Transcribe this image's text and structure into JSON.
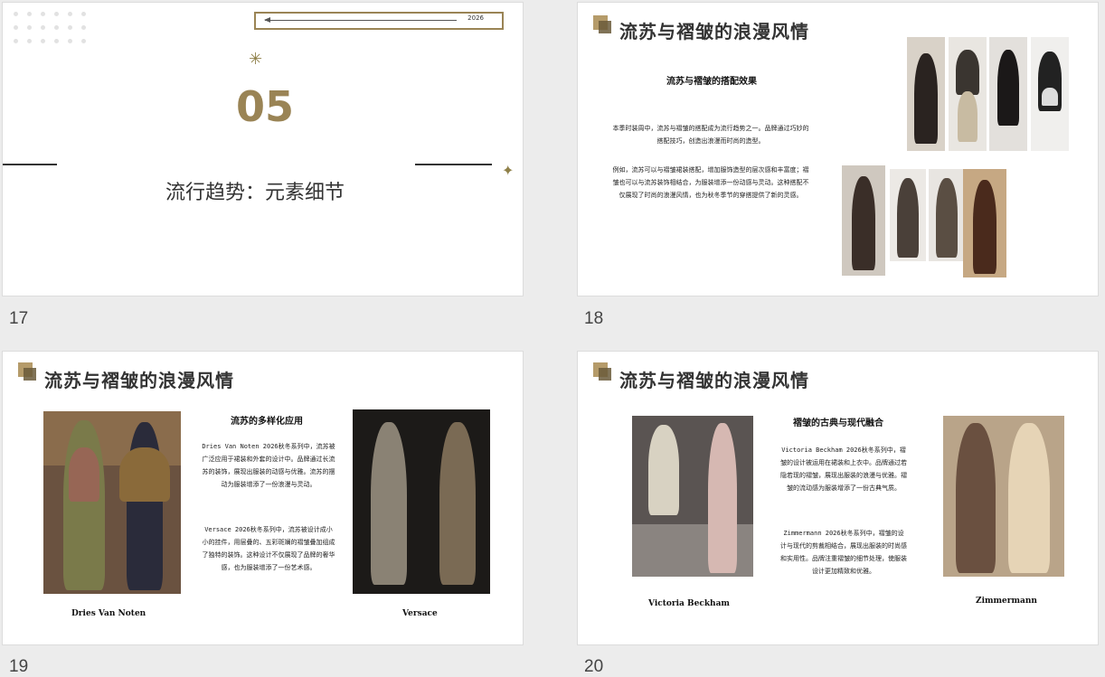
{
  "slides": [
    {
      "number": "17",
      "year": "2026",
      "big_number": "05",
      "subtitle": "流行趋势：元素细节"
    },
    {
      "number": "18",
      "title": "流苏与褶皱的浪漫风情",
      "subheading": "流苏与褶皱的搭配效果",
      "p1": "本季时装周中，流苏与褶皱的搭配成为流行趋势之一。品牌通过巧妙的搭配技巧，创造出浪漫而时尚的造型。",
      "p2": "例如，流苏可以与褶皱裙装搭配，增加服饰造型的层次感和丰富度；褶皱也可以与流苏装饰相结合，为服装增添一份动感与灵动。这种搭配不仅展现了时尚的浪漫风情，也为秋冬季节的穿搭提供了新的灵感。"
    },
    {
      "number": "19",
      "title": "流苏与褶皱的浪漫风情",
      "subheading": "流苏的多样化应用",
      "p1": "Dries Van Noten 2026秋冬系列中，流苏被广泛应用于裙装和外套的设计中。品牌通过长流苏的装饰，展现出服装的动感与优雅。流苏的摆动为服装增添了一份浪漫与灵动。",
      "p2": "Versace 2026秋冬系列中，流苏被设计成小小的挂件，用层叠的、五彩斑斓的褶皱叠加组成了独特的装饰。这种设计不仅展现了品牌的奢华感，也为服装增添了一份艺术感。",
      "caption_left": "Dries Van Noten",
      "caption_right": "Versace"
    },
    {
      "number": "20",
      "title": "流苏与褶皱的浪漫风情",
      "subheading": "褶皱的古典与现代融合",
      "p1": "Victoria Beckham 2026秋冬系列中，褶皱的设计被运用在裙装和上衣中。品牌通过若隐若现的褶皱，展现出服装的浪漫与优雅。褶皱的流动感为服装增添了一份古典气质。",
      "p2": "Zimmermann 2026秋冬系列中，褶皱的设计与现代的剪裁相结合，展现出服装的时尚感和实用性。品牌注重褶皱的细节处理，使服装设计更加精致和优雅。",
      "caption_left": "Victoria Beckham",
      "caption_right": "Zimmermann"
    }
  ],
  "colors": {
    "accent": "#9a8455",
    "background": "#ececec",
    "slide": "#ffffff"
  }
}
